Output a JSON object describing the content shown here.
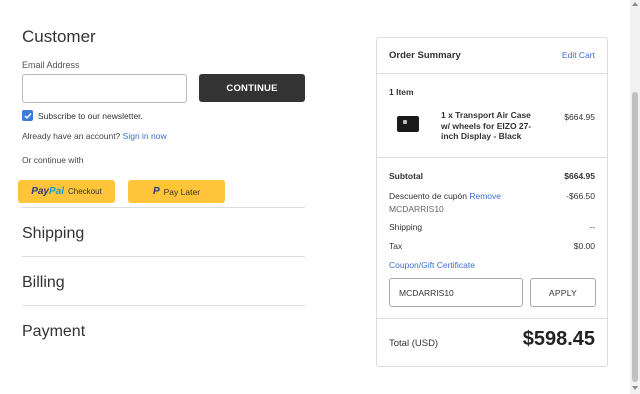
{
  "customer": {
    "title": "Customer",
    "email_label": "Email Address",
    "email_value": "",
    "continue_label": "CONTINUE",
    "subscribe_label": "Subscribe to our newsletter.",
    "have_account_text": "Already have an account?",
    "sign_in_link": "Sign in now",
    "or_continue_text": "Or continue with",
    "paypal_pay": "Pay",
    "paypal_pal": "Pal",
    "paypal_checkout": "Checkout",
    "paylater_label": "Pay Later"
  },
  "sections": {
    "shipping": "Shipping",
    "billing": "Billing",
    "payment": "Payment"
  },
  "summary": {
    "title": "Order Summary",
    "edit_cart": "Edit Cart",
    "items_count": "1 Item",
    "product_name": "1 x Transport Air Case w/ wheels for EIZO 27-inch Display - Black",
    "product_price": "$664.95",
    "subtotal_label": "Subtotal",
    "subtotal_value": "$664.95",
    "discount_label": "Descuento de cupón",
    "remove_link": "Remove",
    "discount_code": "MCDARRIS10",
    "discount_value": "-$66.50",
    "shipping_label": "Shipping",
    "shipping_value": "--",
    "tax_label": "Tax",
    "tax_value": "$0.00",
    "coupon_link": "Coupon/Gift Certificate",
    "coupon_input_value": "MCDARRIS10",
    "apply_label": "APPLY",
    "total_label": "Total (USD)",
    "total_value": "$598.45"
  },
  "colors": {
    "accent": "#3b6fd0",
    "paypal_yellow": "#ffc439",
    "continue_bg": "#333333"
  }
}
